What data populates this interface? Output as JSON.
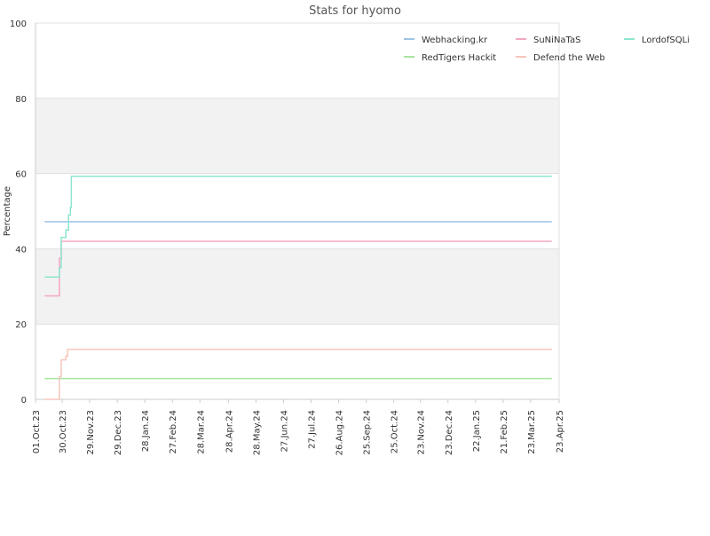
{
  "chart_data": {
    "type": "line",
    "title": "Stats for hyomo",
    "xlabel": "",
    "ylabel": "Percentage",
    "ylim": [
      0,
      100
    ],
    "yticks": [
      0,
      20,
      40,
      60,
      80,
      100
    ],
    "xlim": [
      "2023-10-01",
      "2025-04-23"
    ],
    "xticks": [
      {
        "date": "2023-10-01",
        "label": "01.Oct.23"
      },
      {
        "date": "2023-10-30",
        "label": "30.Oct.23"
      },
      {
        "date": "2023-11-29",
        "label": "29.Nov.23"
      },
      {
        "date": "2023-12-29",
        "label": "29.Dec.23"
      },
      {
        "date": "2024-01-28",
        "label": "28.Jan.24"
      },
      {
        "date": "2024-02-27",
        "label": "27.Feb.24"
      },
      {
        "date": "2024-03-28",
        "label": "28.Mar.24"
      },
      {
        "date": "2024-04-28",
        "label": "28.Apr.24"
      },
      {
        "date": "2024-05-28",
        "label": "28.May.24"
      },
      {
        "date": "2024-06-27",
        "label": "27.Jun.24"
      },
      {
        "date": "2024-07-27",
        "label": "27.Jul.24"
      },
      {
        "date": "2024-08-26",
        "label": "26.Aug.24"
      },
      {
        "date": "2024-09-25",
        "label": "25.Sep.24"
      },
      {
        "date": "2024-10-25",
        "label": "25.Oct.24"
      },
      {
        "date": "2024-11-23",
        "label": "23.Nov.24"
      },
      {
        "date": "2024-12-23",
        "label": "23.Dec.24"
      },
      {
        "date": "2025-01-22",
        "label": "22.Jan.25"
      },
      {
        "date": "2025-02-21",
        "label": "21.Feb.25"
      },
      {
        "date": "2025-03-23",
        "label": "23.Mar.25"
      },
      {
        "date": "2025-04-23",
        "label": "23.Apr.25"
      }
    ],
    "grid": true,
    "bands": [
      [
        20,
        40
      ],
      [
        60,
        80
      ]
    ],
    "band_color": "#f2f2f2",
    "legend_position": "top-right",
    "series": [
      {
        "name": "Webhacking.kr",
        "color": "#9dc3e6",
        "points": [
          [
            "2023-10-11",
            47.2
          ],
          [
            "2025-04-15",
            47.2
          ]
        ]
      },
      {
        "name": "SuNiNaTaS",
        "color": "#f4a7c0",
        "points": [
          [
            "2023-10-11",
            27.5
          ],
          [
            "2023-10-27",
            27.5
          ],
          [
            "2023-10-27",
            37.5
          ],
          [
            "2023-10-29",
            37.5
          ],
          [
            "2023-10-29",
            42
          ],
          [
            "2025-04-15",
            42
          ]
        ]
      },
      {
        "name": "LordofSQLi",
        "color": "#8de5cf",
        "points": [
          [
            "2023-10-11",
            32.5
          ],
          [
            "2023-10-27",
            32.5
          ],
          [
            "2023-10-27",
            35
          ],
          [
            "2023-10-29",
            35
          ],
          [
            "2023-10-29",
            43
          ],
          [
            "2023-11-03",
            43
          ],
          [
            "2023-11-03",
            45
          ],
          [
            "2023-11-06",
            45
          ],
          [
            "2023-11-06",
            49
          ],
          [
            "2023-11-08",
            49
          ],
          [
            "2023-11-08",
            51
          ],
          [
            "2023-11-09",
            51
          ],
          [
            "2023-11-09",
            59.3
          ],
          [
            "2025-04-15",
            59.3
          ]
        ]
      },
      {
        "name": "RedTigers Hackit",
        "color": "#a8e6a0",
        "points": [
          [
            "2023-10-11",
            5.5
          ],
          [
            "2025-04-15",
            5.5
          ]
        ]
      },
      {
        "name": "Defend the Web",
        "color": "#f7c5bc",
        "points": [
          [
            "2023-10-11",
            0
          ],
          [
            "2023-10-27",
            0
          ],
          [
            "2023-10-27",
            6
          ],
          [
            "2023-10-29",
            6
          ],
          [
            "2023-10-29",
            10.5
          ],
          [
            "2023-11-03",
            10.5
          ],
          [
            "2023-11-03",
            11.5
          ],
          [
            "2023-11-05",
            11.5
          ],
          [
            "2023-11-05",
            13.3
          ],
          [
            "2025-04-15",
            13.3
          ]
        ]
      }
    ]
  }
}
